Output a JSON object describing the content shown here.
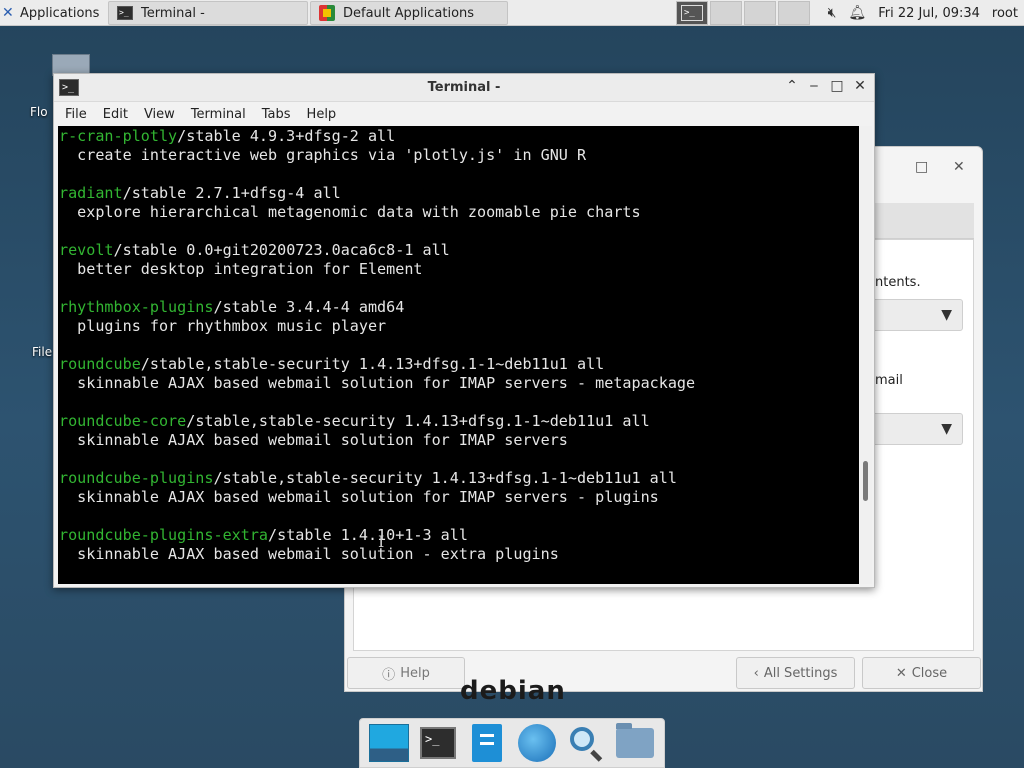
{
  "top_panel": {
    "applications_label": "Applications",
    "tasks": [
      {
        "label": "Terminal -"
      },
      {
        "label": "Default Applications"
      }
    ],
    "clock": "Fri 22 Jul, 09:34",
    "user": "root"
  },
  "desktop": {
    "labels": [
      "Flo",
      "File"
    ]
  },
  "settings_window": {
    "line1": "ntents.",
    "line2": "mail",
    "help_label": "Help",
    "all_settings_label": "All Settings",
    "close_label": "Close",
    "wallpaper_text": "debian"
  },
  "terminal": {
    "title": "Terminal -",
    "menu": [
      "File",
      "Edit",
      "View",
      "Terminal",
      "Tabs",
      "Help"
    ],
    "lines": [
      {
        "pkg": "r-cran-plotly",
        "rest": "/stable 4.9.3+dfsg-2 all"
      },
      {
        "pkg": "",
        "rest": "  create interactive web graphics via 'plotly.js' in GNU R"
      },
      {
        "pkg": "",
        "rest": ""
      },
      {
        "pkg": "radiant",
        "rest": "/stable 2.7.1+dfsg-4 all"
      },
      {
        "pkg": "",
        "rest": "  explore hierarchical metagenomic data with zoomable pie charts"
      },
      {
        "pkg": "",
        "rest": ""
      },
      {
        "pkg": "revolt",
        "rest": "/stable 0.0+git20200723.0aca6c8-1 all"
      },
      {
        "pkg": "",
        "rest": "  better desktop integration for Element"
      },
      {
        "pkg": "",
        "rest": ""
      },
      {
        "pkg": "rhythmbox-plugins",
        "rest": "/stable 3.4.4-4 amd64"
      },
      {
        "pkg": "",
        "rest": "  plugins for rhythmbox music player"
      },
      {
        "pkg": "",
        "rest": ""
      },
      {
        "pkg": "roundcube",
        "rest": "/stable,stable-security 1.4.13+dfsg.1-1~deb11u1 all"
      },
      {
        "pkg": "",
        "rest": "  skinnable AJAX based webmail solution for IMAP servers - metapackage"
      },
      {
        "pkg": "",
        "rest": ""
      },
      {
        "pkg": "roundcube-core",
        "rest": "/stable,stable-security 1.4.13+dfsg.1-1~deb11u1 all"
      },
      {
        "pkg": "",
        "rest": "  skinnable AJAX based webmail solution for IMAP servers"
      },
      {
        "pkg": "",
        "rest": ""
      },
      {
        "pkg": "roundcube-plugins",
        "rest": "/stable,stable-security 1.4.13+dfsg.1-1~deb11u1 all"
      },
      {
        "pkg": "",
        "rest": "  skinnable AJAX based webmail solution for IMAP servers - plugins"
      },
      {
        "pkg": "",
        "rest": ""
      },
      {
        "pkg": "roundcube-plugins-extra",
        "rest": "/stable 1.4.10+1-3 all"
      },
      {
        "pkg": "",
        "rest": "  skinnable AJAX based webmail solution - extra plugins"
      }
    ]
  },
  "colors": {
    "package_name": "#32b532",
    "terminal_bg": "#000000",
    "terminal_fg": "#e6e6e6"
  }
}
